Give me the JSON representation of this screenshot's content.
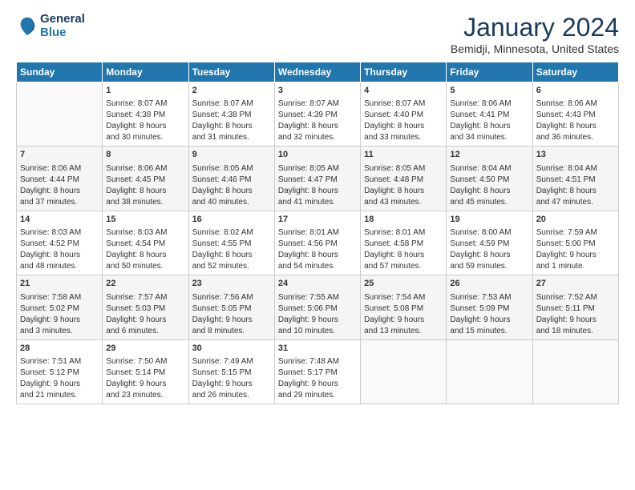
{
  "header": {
    "logo_line1": "General",
    "logo_line2": "Blue",
    "title": "January 2024",
    "subtitle": "Bemidji, Minnesota, United States"
  },
  "days_of_week": [
    "Sunday",
    "Monday",
    "Tuesday",
    "Wednesday",
    "Thursday",
    "Friday",
    "Saturday"
  ],
  "weeks": [
    [
      {
        "day": "",
        "sunrise": "",
        "sunset": "",
        "daylight": ""
      },
      {
        "day": "1",
        "sunrise": "Sunrise: 8:07 AM",
        "sunset": "Sunset: 4:38 PM",
        "daylight": "Daylight: 8 hours and 30 minutes."
      },
      {
        "day": "2",
        "sunrise": "Sunrise: 8:07 AM",
        "sunset": "Sunset: 4:38 PM",
        "daylight": "Daylight: 8 hours and 31 minutes."
      },
      {
        "day": "3",
        "sunrise": "Sunrise: 8:07 AM",
        "sunset": "Sunset: 4:39 PM",
        "daylight": "Daylight: 8 hours and 32 minutes."
      },
      {
        "day": "4",
        "sunrise": "Sunrise: 8:07 AM",
        "sunset": "Sunset: 4:40 PM",
        "daylight": "Daylight: 8 hours and 33 minutes."
      },
      {
        "day": "5",
        "sunrise": "Sunrise: 8:06 AM",
        "sunset": "Sunset: 4:41 PM",
        "daylight": "Daylight: 8 hours and 34 minutes."
      },
      {
        "day": "6",
        "sunrise": "Sunrise: 8:06 AM",
        "sunset": "Sunset: 4:43 PM",
        "daylight": "Daylight: 8 hours and 36 minutes."
      }
    ],
    [
      {
        "day": "7",
        "sunrise": "Sunrise: 8:06 AM",
        "sunset": "Sunset: 4:44 PM",
        "daylight": "Daylight: 8 hours and 37 minutes."
      },
      {
        "day": "8",
        "sunrise": "Sunrise: 8:06 AM",
        "sunset": "Sunset: 4:45 PM",
        "daylight": "Daylight: 8 hours and 38 minutes."
      },
      {
        "day": "9",
        "sunrise": "Sunrise: 8:05 AM",
        "sunset": "Sunset: 4:46 PM",
        "daylight": "Daylight: 8 hours and 40 minutes."
      },
      {
        "day": "10",
        "sunrise": "Sunrise: 8:05 AM",
        "sunset": "Sunset: 4:47 PM",
        "daylight": "Daylight: 8 hours and 41 minutes."
      },
      {
        "day": "11",
        "sunrise": "Sunrise: 8:05 AM",
        "sunset": "Sunset: 4:48 PM",
        "daylight": "Daylight: 8 hours and 43 minutes."
      },
      {
        "day": "12",
        "sunrise": "Sunrise: 8:04 AM",
        "sunset": "Sunset: 4:50 PM",
        "daylight": "Daylight: 8 hours and 45 minutes."
      },
      {
        "day": "13",
        "sunrise": "Sunrise: 8:04 AM",
        "sunset": "Sunset: 4:51 PM",
        "daylight": "Daylight: 8 hours and 47 minutes."
      }
    ],
    [
      {
        "day": "14",
        "sunrise": "Sunrise: 8:03 AM",
        "sunset": "Sunset: 4:52 PM",
        "daylight": "Daylight: 8 hours and 48 minutes."
      },
      {
        "day": "15",
        "sunrise": "Sunrise: 8:03 AM",
        "sunset": "Sunset: 4:54 PM",
        "daylight": "Daylight: 8 hours and 50 minutes."
      },
      {
        "day": "16",
        "sunrise": "Sunrise: 8:02 AM",
        "sunset": "Sunset: 4:55 PM",
        "daylight": "Daylight: 8 hours and 52 minutes."
      },
      {
        "day": "17",
        "sunrise": "Sunrise: 8:01 AM",
        "sunset": "Sunset: 4:56 PM",
        "daylight": "Daylight: 8 hours and 54 minutes."
      },
      {
        "day": "18",
        "sunrise": "Sunrise: 8:01 AM",
        "sunset": "Sunset: 4:58 PM",
        "daylight": "Daylight: 8 hours and 57 minutes."
      },
      {
        "day": "19",
        "sunrise": "Sunrise: 8:00 AM",
        "sunset": "Sunset: 4:59 PM",
        "daylight": "Daylight: 8 hours and 59 minutes."
      },
      {
        "day": "20",
        "sunrise": "Sunrise: 7:59 AM",
        "sunset": "Sunset: 5:00 PM",
        "daylight": "Daylight: 9 hours and 1 minute."
      }
    ],
    [
      {
        "day": "21",
        "sunrise": "Sunrise: 7:58 AM",
        "sunset": "Sunset: 5:02 PM",
        "daylight": "Daylight: 9 hours and 3 minutes."
      },
      {
        "day": "22",
        "sunrise": "Sunrise: 7:57 AM",
        "sunset": "Sunset: 5:03 PM",
        "daylight": "Daylight: 9 hours and 6 minutes."
      },
      {
        "day": "23",
        "sunrise": "Sunrise: 7:56 AM",
        "sunset": "Sunset: 5:05 PM",
        "daylight": "Daylight: 9 hours and 8 minutes."
      },
      {
        "day": "24",
        "sunrise": "Sunrise: 7:55 AM",
        "sunset": "Sunset: 5:06 PM",
        "daylight": "Daylight: 9 hours and 10 minutes."
      },
      {
        "day": "25",
        "sunrise": "Sunrise: 7:54 AM",
        "sunset": "Sunset: 5:08 PM",
        "daylight": "Daylight: 9 hours and 13 minutes."
      },
      {
        "day": "26",
        "sunrise": "Sunrise: 7:53 AM",
        "sunset": "Sunset: 5:09 PM",
        "daylight": "Daylight: 9 hours and 15 minutes."
      },
      {
        "day": "27",
        "sunrise": "Sunrise: 7:52 AM",
        "sunset": "Sunset: 5:11 PM",
        "daylight": "Daylight: 9 hours and 18 minutes."
      }
    ],
    [
      {
        "day": "28",
        "sunrise": "Sunrise: 7:51 AM",
        "sunset": "Sunset: 5:12 PM",
        "daylight": "Daylight: 9 hours and 21 minutes."
      },
      {
        "day": "29",
        "sunrise": "Sunrise: 7:50 AM",
        "sunset": "Sunset: 5:14 PM",
        "daylight": "Daylight: 9 hours and 23 minutes."
      },
      {
        "day": "30",
        "sunrise": "Sunrise: 7:49 AM",
        "sunset": "Sunset: 5:15 PM",
        "daylight": "Daylight: 9 hours and 26 minutes."
      },
      {
        "day": "31",
        "sunrise": "Sunrise: 7:48 AM",
        "sunset": "Sunset: 5:17 PM",
        "daylight": "Daylight: 9 hours and 29 minutes."
      },
      {
        "day": "",
        "sunrise": "",
        "sunset": "",
        "daylight": ""
      },
      {
        "day": "",
        "sunrise": "",
        "sunset": "",
        "daylight": ""
      },
      {
        "day": "",
        "sunrise": "",
        "sunset": "",
        "daylight": ""
      }
    ]
  ]
}
